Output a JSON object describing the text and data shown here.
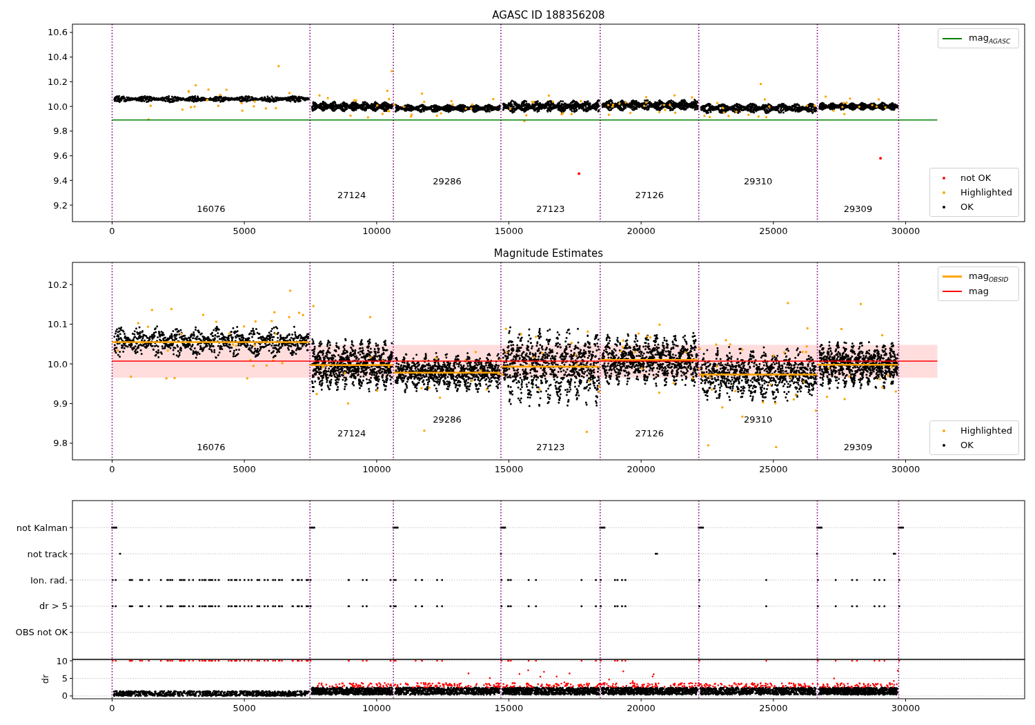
{
  "figure": {
    "panels": [
      {
        "title": "AGASC ID 188356208",
        "chart_data": {
          "type": "scatter",
          "xlim": [
            -1500,
            34500
          ],
          "ylim": [
            9.066,
            10.667
          ],
          "xticks": [
            {
              "value": 0,
              "label": "0"
            },
            {
              "value": 5000,
              "label": "5000"
            },
            {
              "value": 10000,
              "label": "10000"
            },
            {
              "value": 15000,
              "label": "15000"
            },
            {
              "value": 20000,
              "label": "20000"
            },
            {
              "value": 25000,
              "label": "25000"
            },
            {
              "value": 30000,
              "label": "30000"
            }
          ],
          "yticks": [
            {
              "value": 9.2,
              "label": "9.2"
            },
            {
              "value": 9.4,
              "label": "9.4"
            },
            {
              "value": 9.6,
              "label": "9.6"
            },
            {
              "value": 9.8,
              "label": "9.8"
            },
            {
              "value": 10.0,
              "label": "10.0"
            },
            {
              "value": 10.2,
              "label": "10.2"
            },
            {
              "value": 10.4,
              "label": "10.4"
            },
            {
              "value": 10.6,
              "label": "10.6"
            }
          ],
          "series": [
            {
              "name": "mag$_{AGASC}$",
              "type": "line",
              "color": "#008000",
              "x": [
                0,
                31200
              ],
              "values": [
                9.89,
                9.89
              ]
            }
          ],
          "legend": true,
          "ref_lines": [
            {
              "axis": "x",
              "value": 0
            },
            {
              "axis": "x",
              "value": 7480
            },
            {
              "axis": "x",
              "value": 10633
            },
            {
              "axis": "x",
              "value": 14699
            },
            {
              "axis": "x",
              "value": 18452
            },
            {
              "axis": "x",
              "value": 22179
            },
            {
              "axis": "x",
              "value": 26662
            },
            {
              "axis": "x",
              "value": 29737
            }
          ],
          "annotations": [
            "16076",
            "27124",
            "29286",
            "27123",
            "27126",
            "29310",
            "29309"
          ]
        },
        "legend": [
          {
            "label": "not OK",
            "color": "#ff0000"
          },
          {
            "label": "Highlighted",
            "color": "#ffa500"
          },
          {
            "label": "OK",
            "color": "#000000"
          }
        ]
      },
      {
        "title": "Magnitude Estimates",
        "chart_data": {
          "type": "scatter",
          "xlim": [
            -1500,
            34500
          ],
          "ylim": [
            9.758,
            10.256
          ],
          "xticks": [
            {
              "value": 0,
              "label": "0"
            },
            {
              "value": 5000,
              "label": "5000"
            },
            {
              "value": 10000,
              "label": "10000"
            },
            {
              "value": 15000,
              "label": "15000"
            },
            {
              "value": 20000,
              "label": "20000"
            },
            {
              "value": 25000,
              "label": "25000"
            },
            {
              "value": 30000,
              "label": "30000"
            }
          ],
          "yticks": [
            {
              "value": 9.8,
              "label": "9.8"
            },
            {
              "value": 9.9,
              "label": "9.9"
            },
            {
              "value": 10.0,
              "label": "10.0"
            },
            {
              "value": 10.1,
              "label": "10.1"
            },
            {
              "value": 10.2,
              "label": "10.2"
            }
          ],
          "series": [
            {
              "name": "mag$_{OBSID}$",
              "type": "line",
              "color": "#ffa500",
              "x": [
                0,
                7480,
                null,
                7480,
                10633,
                null,
                10633,
                14699,
                null,
                14699,
                18452,
                null,
                18452,
                22179,
                null,
                22179,
                26662,
                null,
                26662,
                29737
              ],
              "values": [
                10.055,
                10.055,
                null,
                9.997,
                9.997,
                null,
                9.978,
                9.978,
                null,
                9.993,
                9.993,
                null,
                10.01,
                10.01,
                null,
                9.973,
                9.973,
                null,
                9.998,
                9.998
              ]
            },
            {
              "name": "mag",
              "type": "line",
              "color": "#ff0000",
              "x": [
                0,
                31200
              ],
              "values": [
                10.007,
                10.007
              ]
            }
          ],
          "legend": true,
          "bands": [
            {
              "axis": "y",
              "from": 9.965,
              "to": 10.048
            }
          ],
          "ref_lines": [
            {
              "axis": "x",
              "value": 0
            },
            {
              "axis": "x",
              "value": 7480
            },
            {
              "axis": "x",
              "value": 10633
            },
            {
              "axis": "x",
              "value": 14699
            },
            {
              "axis": "x",
              "value": 18452
            },
            {
              "axis": "x",
              "value": 22179
            },
            {
              "axis": "x",
              "value": 26662
            },
            {
              "axis": "x",
              "value": 29737
            }
          ],
          "annotations": [
            "16076",
            "27124",
            "29286",
            "27123",
            "27126",
            "29310",
            "29309"
          ]
        },
        "legend": [
          {
            "label": "Highlighted",
            "color": "#ffa500"
          },
          {
            "label": "OK",
            "color": "#000000"
          }
        ]
      },
      {
        "flag_rows": [
          "not Kalman",
          "not track",
          "Ion. rad.",
          "dr > 5",
          "OBS not OK"
        ]
      },
      {
        "chart_data": {
          "type": "scatter",
          "ylabel": "dr",
          "xlim": [
            -1500,
            34500
          ],
          "ylim": [
            -0.8,
            10.4
          ],
          "xticks": [
            {
              "value": 0,
              "label": "0"
            },
            {
              "value": 5000,
              "label": "5000"
            },
            {
              "value": 10000,
              "label": "10000"
            },
            {
              "value": 15000,
              "label": "15000"
            },
            {
              "value": 20000,
              "label": "20000"
            },
            {
              "value": 25000,
              "label": "25000"
            },
            {
              "value": 30000,
              "label": "30000"
            }
          ],
          "yticks": [
            {
              "value": 0,
              "label": "0"
            },
            {
              "value": 5,
              "label": "5"
            },
            {
              "value": 10,
              "label": "10"
            }
          ],
          "ref_lines": [
            {
              "axis": "x",
              "value": 0
            },
            {
              "axis": "x",
              "value": 7480
            },
            {
              "axis": "x",
              "value": 10633
            },
            {
              "axis": "x",
              "value": 14699
            },
            {
              "axis": "x",
              "value": 18452
            },
            {
              "axis": "x",
              "value": 22179
            },
            {
              "axis": "x",
              "value": 26662
            },
            {
              "axis": "x",
              "value": 29737
            }
          ]
        }
      }
    ]
  }
}
